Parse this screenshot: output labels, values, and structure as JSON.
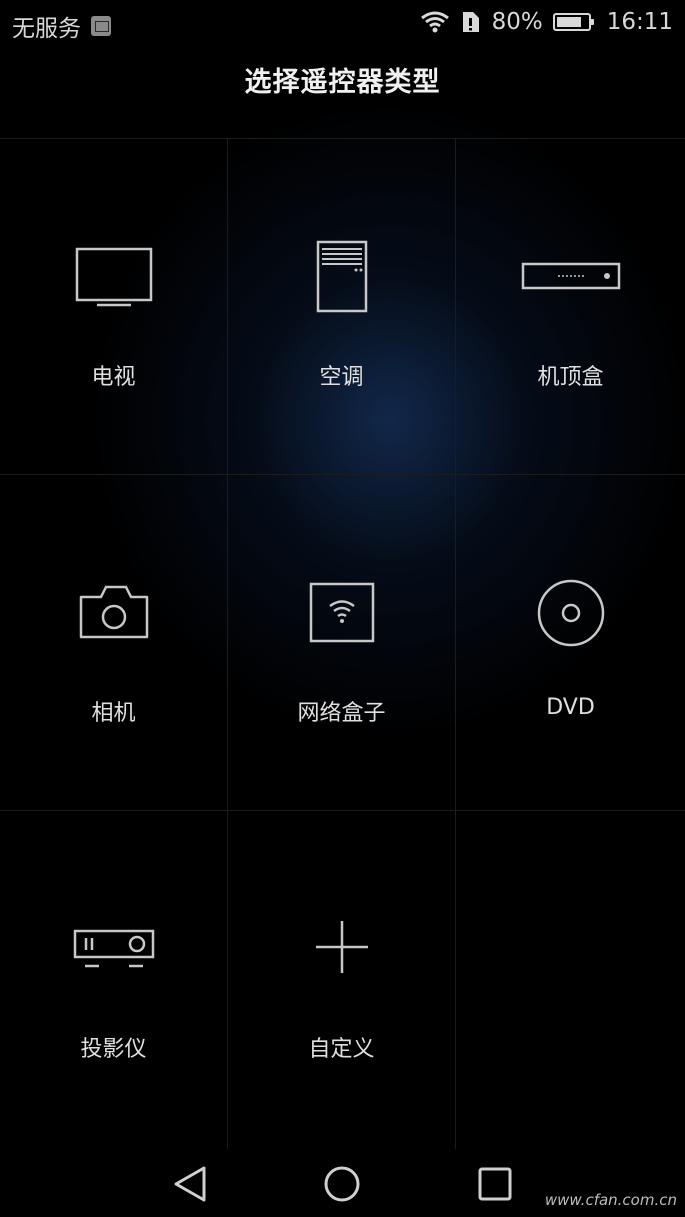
{
  "status_bar": {
    "carrier": "无服务",
    "battery_text": "80%",
    "battery_level": 0.8,
    "time": "16:11"
  },
  "header": {
    "title": "选择遥控器类型"
  },
  "devices": [
    {
      "label": "电视",
      "icon": "tv-icon"
    },
    {
      "label": "空调",
      "icon": "air-conditioner-icon"
    },
    {
      "label": "机顶盒",
      "icon": "set-top-box-icon"
    },
    {
      "label": "相机",
      "icon": "camera-icon"
    },
    {
      "label": "网络盒子",
      "icon": "network-box-icon"
    },
    {
      "label": "DVD",
      "icon": "disc-icon"
    },
    {
      "label": "投影仪",
      "icon": "projector-icon"
    },
    {
      "label": "自定义",
      "icon": "plus-icon"
    }
  ],
  "nav_bar": {
    "back": "back-triangle-icon",
    "home": "home-circle-icon",
    "recents": "recents-square-icon"
  },
  "watermark": "www.cfan.com.cn",
  "colors": {
    "background": "#000000",
    "glow": "#122a4e",
    "icon_stroke": "#c8c8c8"
  }
}
